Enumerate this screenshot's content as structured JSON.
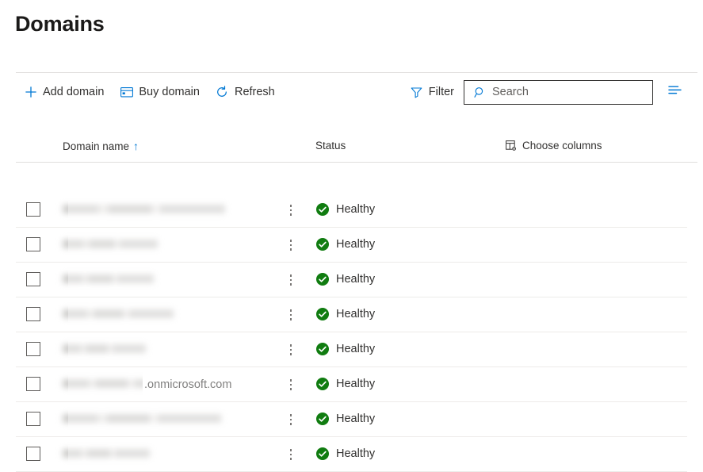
{
  "page": {
    "title": "Domains"
  },
  "toolbar": {
    "add_domain": "Add domain",
    "buy_domain": "Buy domain",
    "refresh": "Refresh",
    "filter": "Filter",
    "search_placeholder": "Search",
    "search_value": "",
    "icons": {
      "add": "plus-icon",
      "buy": "credit-card-icon",
      "refresh": "refresh-icon",
      "filter": "filter-icon",
      "search": "search-icon",
      "list_view": "list-view-icon"
    }
  },
  "table": {
    "columns": {
      "domain_name": "Domain name",
      "sort_indicator": "↑",
      "status": "Status",
      "choose_columns": "Choose columns"
    },
    "rows": [
      {
        "domain": "",
        "redacted": true,
        "clear_suffix": "",
        "status": "Healthy",
        "status_icon": "check-circle-icon"
      },
      {
        "domain": "",
        "redacted": true,
        "clear_suffix": "",
        "status": "Healthy",
        "status_icon": "check-circle-icon"
      },
      {
        "domain": "",
        "redacted": true,
        "clear_suffix": "",
        "status": "Healthy",
        "status_icon": "check-circle-icon"
      },
      {
        "domain": "",
        "redacted": true,
        "clear_suffix": "",
        "status": "Healthy",
        "status_icon": "check-circle-icon"
      },
      {
        "domain": "",
        "redacted": true,
        "clear_suffix": "",
        "status": "Healthy",
        "status_icon": "check-circle-icon"
      },
      {
        "domain": "",
        "redacted": true,
        "clear_suffix": ".onmicrosoft.com",
        "status": "Healthy",
        "status_icon": "check-circle-icon"
      },
      {
        "domain": "",
        "redacted": true,
        "clear_suffix": "",
        "status": "Healthy",
        "status_icon": "check-circle-icon"
      },
      {
        "domain": "",
        "redacted": true,
        "clear_suffix": "",
        "status": "Healthy",
        "status_icon": "check-circle-icon"
      }
    ]
  },
  "colors": {
    "accent": "#0078d4",
    "status_healthy": "#107c10",
    "text": "#323130",
    "title": "#1b1a19",
    "divider": "#e1dfdd",
    "row_divider": "#edebe9",
    "background": "#ffffff"
  }
}
